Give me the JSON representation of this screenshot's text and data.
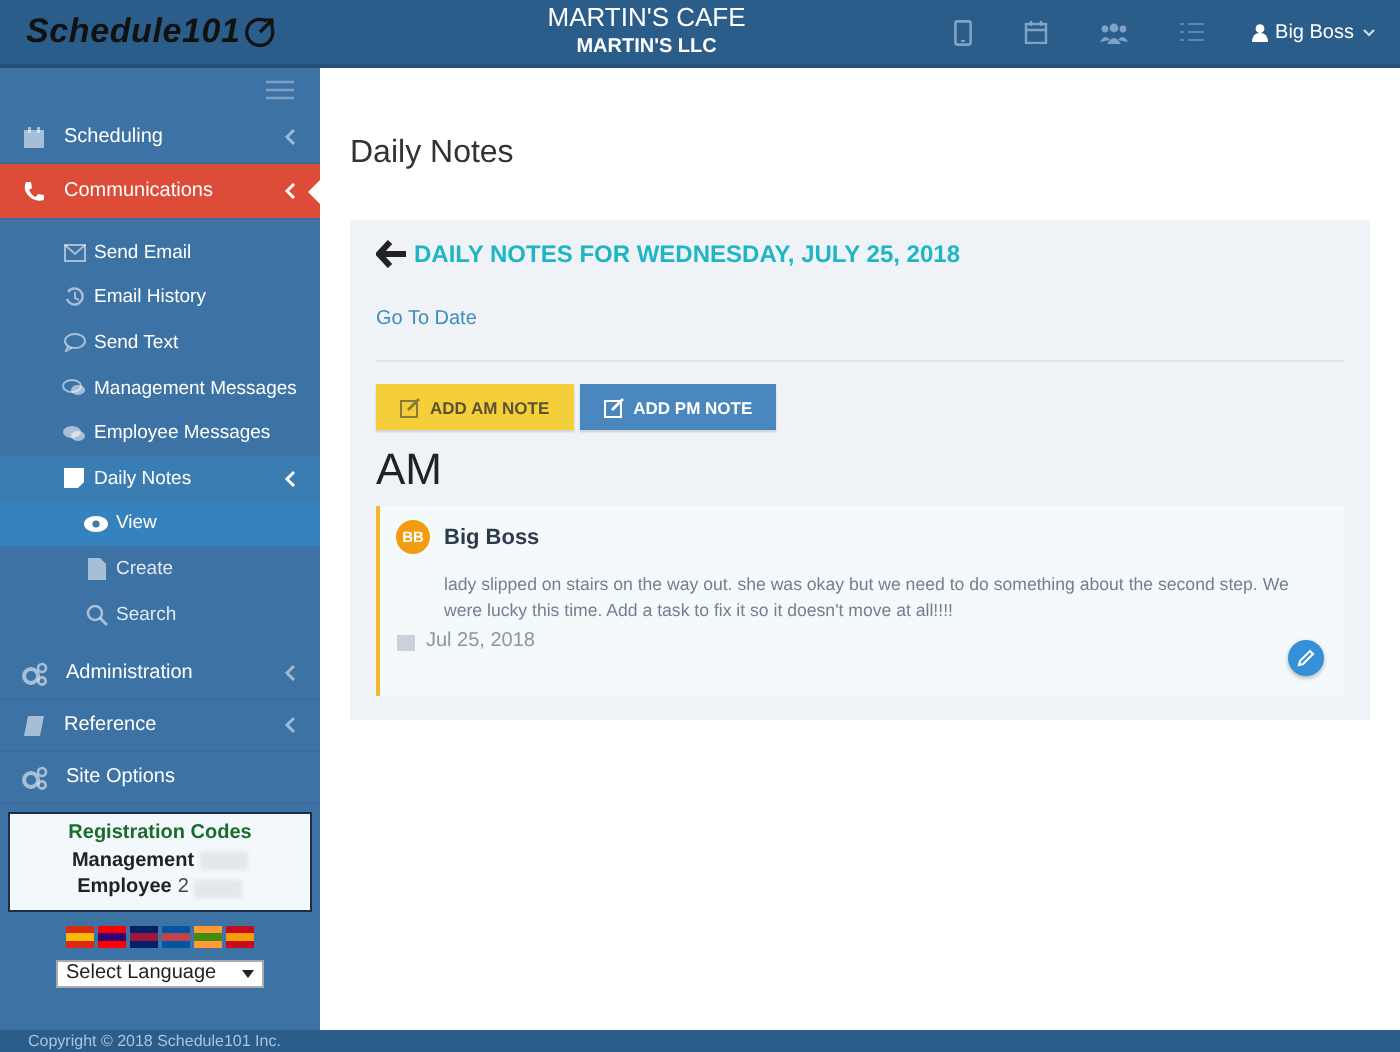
{
  "header": {
    "brand": "Schedule101",
    "title": "MARTIN'S CAFE",
    "subtitle": "MARTIN'S LLC",
    "user": "Big Boss"
  },
  "sidebar": {
    "items": [
      {
        "label": "Scheduling",
        "selected": false,
        "expanded": false,
        "expandable": true
      },
      {
        "label": "Communications",
        "selected": true,
        "expanded": true,
        "expandable": true,
        "children": [
          {
            "label": "Send Email",
            "selected": false,
            "expanded": false,
            "expandable": false
          },
          {
            "label": "Email History",
            "selected": false,
            "expanded": false,
            "expandable": false
          },
          {
            "label": "Send Text",
            "selected": false,
            "expanded": false,
            "expandable": false
          },
          {
            "label": "Management Messages",
            "selected": false,
            "expanded": false,
            "expandable": false
          },
          {
            "label": "Employee Messages",
            "selected": false,
            "expanded": false,
            "expandable": false
          },
          {
            "label": "Daily Notes",
            "selected": true,
            "expanded": true,
            "expandable": true,
            "children": [
              {
                "label": "View",
                "selected": true
              },
              {
                "label": "Create",
                "selected": false
              },
              {
                "label": "Search",
                "selected": false
              }
            ]
          }
        ]
      },
      {
        "label": "Administration",
        "selected": false,
        "expanded": false,
        "expandable": true
      },
      {
        "label": "Reference",
        "selected": false,
        "expanded": false,
        "expandable": true
      },
      {
        "label": "Site Options",
        "selected": false,
        "expanded": false,
        "expandable": false
      }
    ],
    "registration": {
      "title": "Registration Codes",
      "rows": [
        {
          "label": "Management",
          "value": ""
        },
        {
          "label": "Employee",
          "value": "2"
        }
      ]
    },
    "language_select": {
      "value": "Select Language"
    }
  },
  "page_title": "Daily Notes",
  "panel": {
    "heading": "DAILY NOTES FOR WEDNESDAY, JULY 25, 2018",
    "link": "Go To Date",
    "buttons": [
      {
        "label": "ADD AM NOTE",
        "kind": "warning"
      },
      {
        "label": "ADD PM NOTE",
        "kind": "primary"
      }
    ],
    "section": "AM",
    "notes": [
      {
        "initials": "BB",
        "author": "Big Boss",
        "text": "lady slipped on stairs on the way out. she was okay but we need to do something about the second step. We were lucky this time. Add a task to fix it so it doesn't move at all!!!!",
        "date": "Jul 25, 2018"
      }
    ]
  },
  "footer": "Copyright © 2018 Schedule101 Inc."
}
